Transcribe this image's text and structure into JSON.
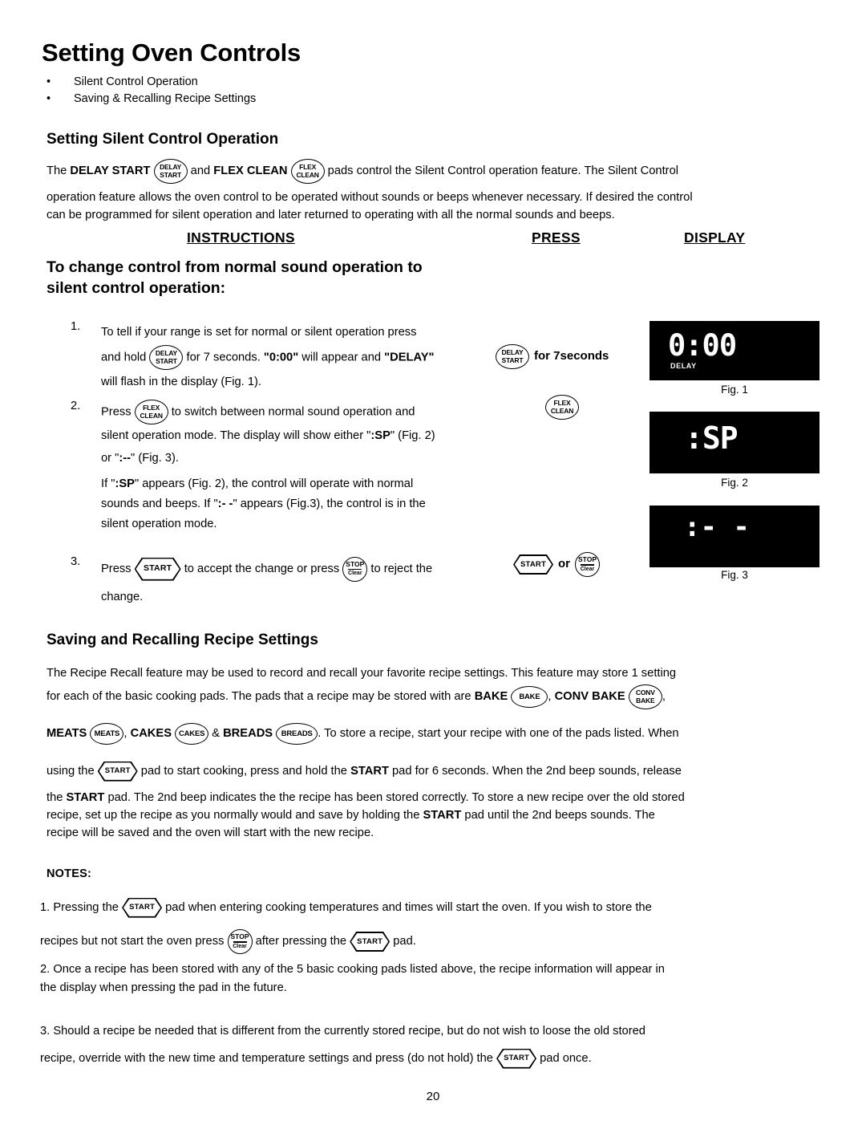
{
  "document": {
    "title": "Setting Oven Controls",
    "bullets": [
      "Silent Control Operation",
      "Saving & Recalling Recipe Settings"
    ],
    "page_number": "20"
  },
  "silent_section": {
    "heading": "Setting Silent Control Operation",
    "intro_p1_a": "The ",
    "intro_p1_b": "DELAY START",
    "intro_p1_c": " and ",
    "intro_p1_d": "FLEX CLEAN",
    "intro_p1_e": " pads control the Silent Control operation feature. The Silent Control",
    "intro_p2": "operation feature allows the oven control to be operated without sounds or beeps whenever necessary. If desired the control",
    "intro_p3": "can be programmed for silent operation and later returned to operating with all the normal sounds and beeps.",
    "columns": {
      "instructions": "INSTRUCTIONS",
      "press": "PRESS",
      "display": "DISPLAY"
    },
    "subheading_line1": "To change control from normal sound operation to",
    "subheading_line2": "silent control operation:",
    "steps": [
      {
        "number": "1.",
        "line1": "To tell if your range is set for normal or silent operation press",
        "line2_a": "and hold ",
        "line2_b": " for 7 seconds. ",
        "line2_c": "\"0:00\"",
        "line2_d": " will appear and ",
        "line2_e": "\"DELAY\"",
        "line3": "will flash in the display (Fig. 1).",
        "press_label": "for 7seconds"
      },
      {
        "number": "2.",
        "line1_a": "Press ",
        "line1_b": " to switch between normal sound operation and",
        "line2_a": "silent operation mode. The display will show either \"",
        "line2_b": ":SP",
        "line2_c": "\" (Fig. 2)",
        "line3_a": "or \"",
        "line3_b": ":--",
        "line3_c": "\" (Fig. 3).",
        "note_line1_a": "If \"",
        "note_line1_b": ":SP",
        "note_line1_c": "\" appears (Fig. 2), the control will operate with normal",
        "note_line2_a": "sounds and beeps.  If \"",
        "note_line2_b": ":- -",
        "note_line2_c": "\" appears (Fig.3), the control is in the",
        "note_line3": "silent operation mode."
      },
      {
        "number": "3.",
        "line1_a": "Press ",
        "line1_b": " to accept the change or press ",
        "line1_c": " to reject the",
        "line2": "change.",
        "press_or": "or"
      }
    ],
    "figures": [
      {
        "caption": "Fig. 1",
        "readout": "0:00",
        "indicator": "DELAY"
      },
      {
        "caption": "Fig. 2",
        "readout": ":SP",
        "indicator": ""
      },
      {
        "caption": "Fig. 3",
        "readout": ":- -",
        "indicator": ""
      }
    ]
  },
  "recipe_section": {
    "heading": "Saving and Recalling Recipe Settings",
    "p1": "The Recipe Recall feature may be used to record and recall your favorite recipe settings. This feature may store 1 setting",
    "p2_a": "for each of the basic cooking pads. The pads that a recipe may be stored with are ",
    "p2_bake": "BAKE",
    "p2_comma": ", ",
    "p2_convbake": "CONV BAKE",
    "p2_end": ",",
    "p3_meats": "MEATS",
    "p3_cakes": "CAKES",
    "p3_amp": " & ",
    "p3_breads": "BREADS",
    "p3_tail": ".  To store a recipe, start your recipe with one of the pads listed. When",
    "p4_a": "using the ",
    "p4_b": " pad to start cooking, press and hold the ",
    "p4_start": "START",
    "p4_c": " pad for 6 seconds. When the 2nd beep sounds, release",
    "p5_a": "the ",
    "p5_start": "START",
    "p5_b": " pad. The 2nd beep indicates the the recipe has been stored correctly. To store a new recipe over the old stored",
    "p6_a": "recipe, set up the recipe as you normally would and save by holding the ",
    "p6_start": "START",
    "p6_b": " pad until the 2nd beeps sounds. The",
    "p7": "recipe will be saved and the oven will start with the new recipe."
  },
  "notes": {
    "title": "NOTES:",
    "items": [
      {
        "number": "1.",
        "line1_a": " Pressing the ",
        "line1_b": " pad when entering cooking temperatures and times will start the oven. If you wish to store the",
        "line2_a": "recipes but not start the oven press ",
        "line2_b": " after pressing the ",
        "line2_c": " pad."
      },
      {
        "number": "2.",
        "line1": " Once a recipe has been stored with any of the 5 basic cooking pads listed above, the recipe information will appear in",
        "line2": "the display when pressing the pad in the future."
      },
      {
        "number": "3.",
        "line1": " Should a recipe be needed that is different from the currently stored recipe, but do not wish to loose the old stored",
        "line2_a": "recipe, override with the new time and temperature settings and press (do not hold) the ",
        "line2_b": " pad once."
      }
    ]
  },
  "pads": {
    "delay_start": {
      "line1": "DELAY",
      "line2": "START",
      "name": "delay-start-pad"
    },
    "flex_clean": {
      "line1": "FLEX",
      "line2": "CLEAN",
      "name": "flex-clean-pad"
    },
    "start": {
      "label": "START",
      "name": "start-pad"
    },
    "stop_clear": {
      "line1": "STOP",
      "line2": "Clear",
      "name": "stop-clear-pad"
    },
    "bake": {
      "label": "BAKE",
      "name": "bake-pad"
    },
    "conv_bake": {
      "line1": "CONV",
      "line2": "BAKE",
      "name": "conv-bake-pad"
    },
    "meats": {
      "label": "MEATS",
      "name": "meats-pad"
    },
    "cakes": {
      "label": "CAKES",
      "name": "cakes-pad"
    },
    "breads": {
      "label": "BREADS",
      "name": "breads-pad"
    }
  },
  "colors": {
    "page_background": "#ffffff",
    "text": "#000000",
    "display_background": "#000000",
    "display_text": "#ffffff"
  }
}
